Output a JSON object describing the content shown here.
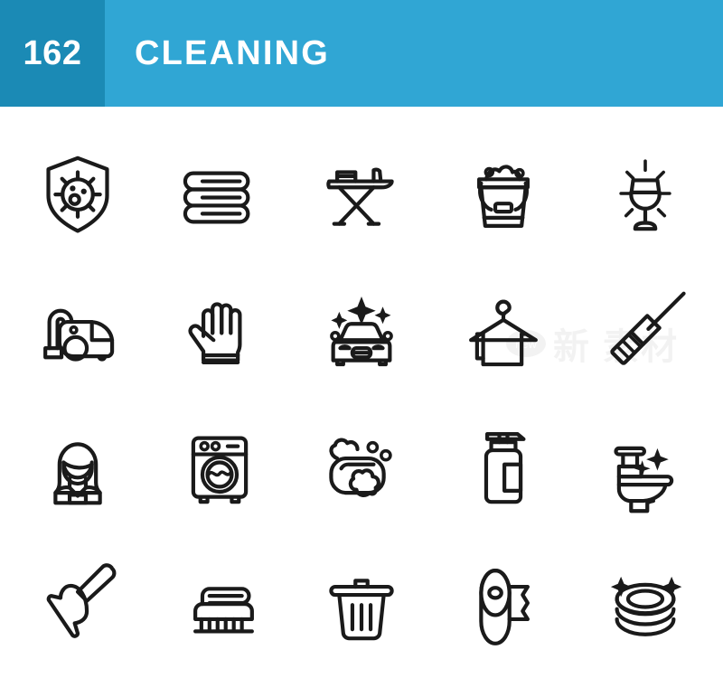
{
  "header": {
    "count": "162",
    "title": "CLEANING",
    "count_bg": "#1b8ab5",
    "title_bg": "#30a6d4",
    "text_color": "#ffffff"
  },
  "watermark": {
    "badge": "new",
    "text": "新 素材"
  },
  "grid": {
    "columns": 5,
    "rows": 4,
    "stroke_color": "#1a1a1a",
    "background": "#ffffff",
    "icons": [
      {
        "name": "shield-virus-icon",
        "label": "Antibacterial Protection Shield"
      },
      {
        "name": "folded-towels-icon",
        "label": "Folded Towels"
      },
      {
        "name": "ironing-board-icon",
        "label": "Ironing Board with Iron"
      },
      {
        "name": "cleaning-bucket-icon",
        "label": "Bucket with Foam"
      },
      {
        "name": "clean-wine-glass-icon",
        "label": "Shiny Clean Wine Glass"
      },
      {
        "name": "vacuum-cleaner-icon",
        "label": "Vacuum Cleaner"
      },
      {
        "name": "cleaning-glove-icon",
        "label": "Rubber Cleaning Glove"
      },
      {
        "name": "car-wash-icon",
        "label": "Car Wash"
      },
      {
        "name": "hanger-towel-icon",
        "label": "Hanger with Towel"
      },
      {
        "name": "broom-icon",
        "label": "Broom"
      },
      {
        "name": "cleaning-lady-icon",
        "label": "Cleaning Lady"
      },
      {
        "name": "washing-machine-icon",
        "label": "Washing Machine"
      },
      {
        "name": "soap-bar-icon",
        "label": "Soap Bar with Bubbles"
      },
      {
        "name": "soap-dispenser-icon",
        "label": "Soap Dispenser"
      },
      {
        "name": "clean-toilet-icon",
        "label": "Clean Toilet"
      },
      {
        "name": "plunger-icon",
        "label": "Plunger"
      },
      {
        "name": "scrub-brush-icon",
        "label": "Scrub Brush"
      },
      {
        "name": "trash-can-icon",
        "label": "Trash Can"
      },
      {
        "name": "toilet-paper-icon",
        "label": "Toilet Paper Roll"
      },
      {
        "name": "clean-dishes-icon",
        "label": "Stack of Clean Dishes"
      }
    ]
  }
}
